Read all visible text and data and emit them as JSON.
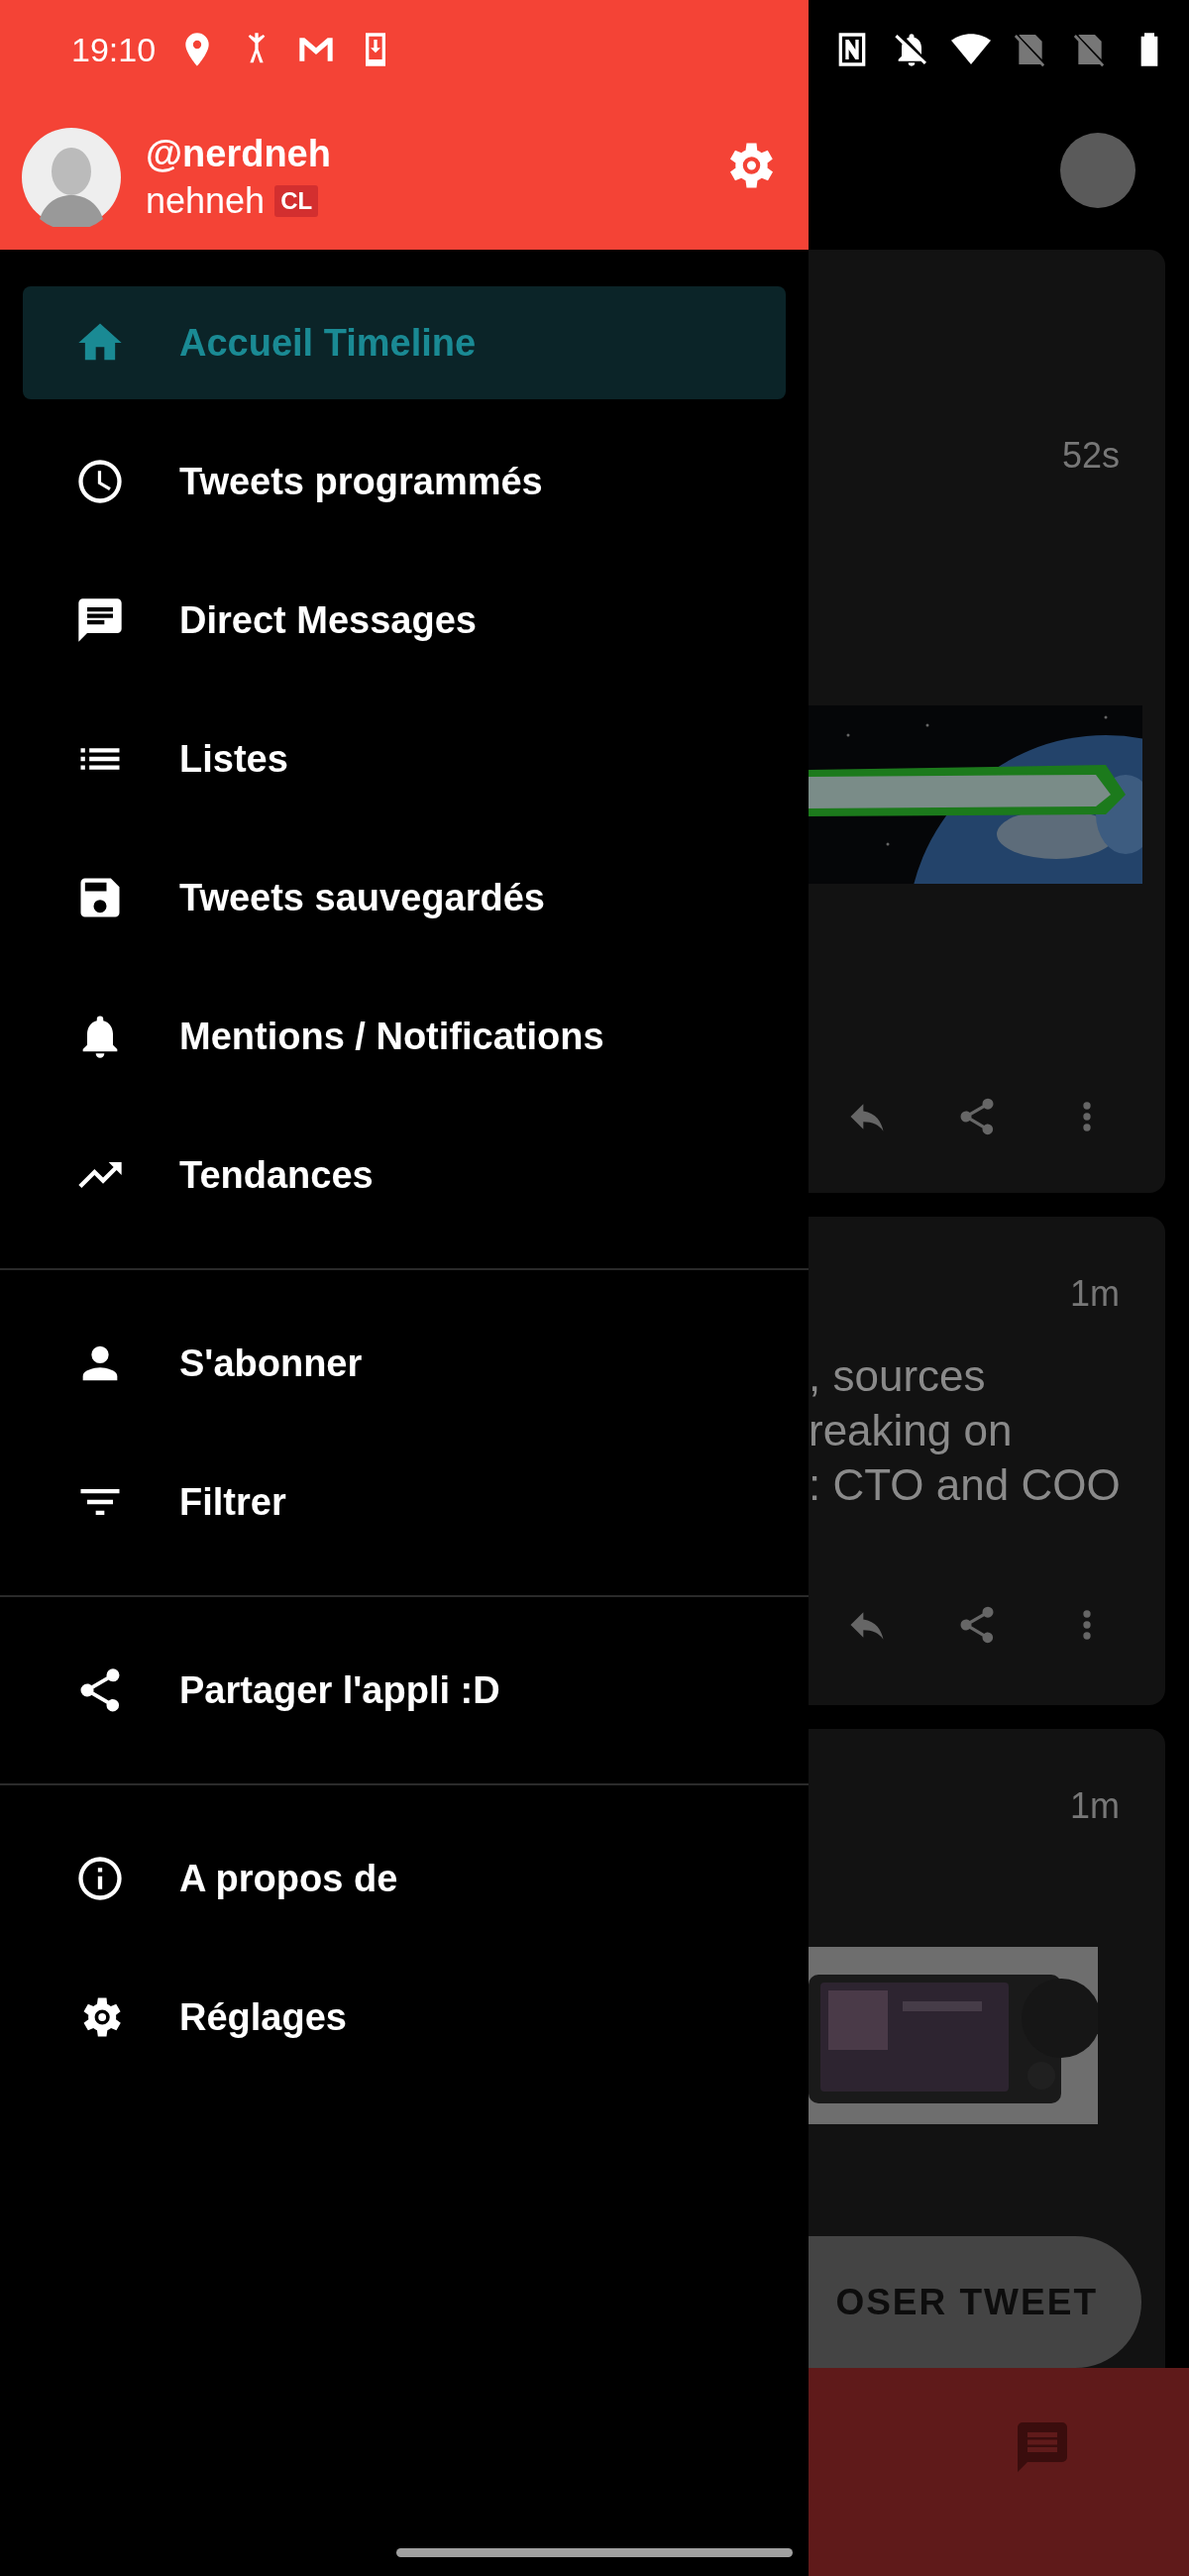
{
  "status_bar": {
    "time": "19:10"
  },
  "drawer": {
    "profile": {
      "handle": "@nerdneh",
      "name": "nehneh",
      "badge": "CL"
    },
    "sections": [
      {
        "items": [
          {
            "label": "Accueil Timeline",
            "selected": true
          },
          {
            "label": "Tweets programmés",
            "selected": false
          },
          {
            "label": "Direct Messages",
            "selected": false
          },
          {
            "label": "Listes",
            "selected": false
          },
          {
            "label": "Tweets sauvegardés",
            "selected": false
          },
          {
            "label": "Mentions / Notifications",
            "selected": false
          },
          {
            "label": "Tendances",
            "selected": false
          }
        ]
      },
      {
        "items": [
          {
            "label": "S'abonner",
            "selected": false
          },
          {
            "label": "Filtrer",
            "selected": false
          }
        ]
      },
      {
        "items": [
          {
            "label": "Partager l'appli :D",
            "selected": false
          }
        ]
      },
      {
        "items": [
          {
            "label": "A propos de",
            "selected": false
          },
          {
            "label": "Réglages",
            "selected": false
          }
        ]
      }
    ]
  },
  "timeline": {
    "cards": [
      {
        "time": "52s",
        "kind": "picture"
      },
      {
        "time": "1m",
        "kind": "text",
        "lines": [
          ", sources",
          "reaking on",
          ": CTO and COO"
        ]
      },
      {
        "time": "1m",
        "kind": "picture"
      }
    ]
  },
  "compose_button": {
    "label": "OSER TWEET"
  }
}
